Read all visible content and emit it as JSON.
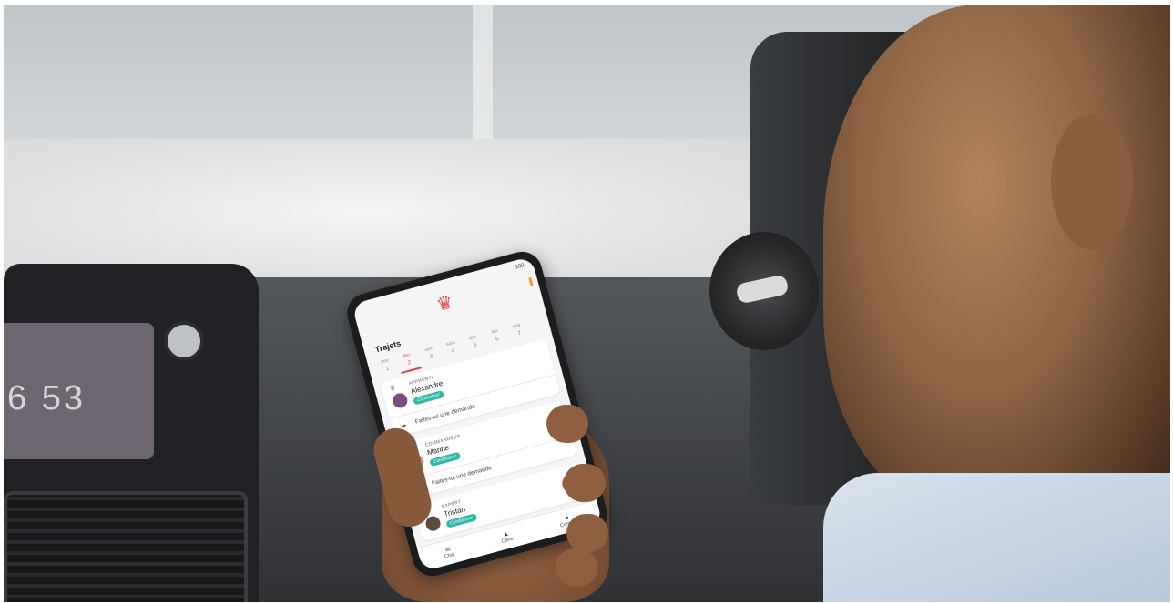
{
  "dashboard": {
    "clock_display": "6 53"
  },
  "phone": {
    "status_text": "100",
    "screen_title": "Trajets",
    "days": [
      {
        "label": "mar.",
        "num": "1"
      },
      {
        "label": "jeu.",
        "num": "2"
      },
      {
        "label": "ven.",
        "num": "3"
      },
      {
        "label": "sam.",
        "num": "4"
      },
      {
        "label": "dim.",
        "num": "5"
      },
      {
        "label": "lun.",
        "num": "6"
      },
      {
        "label": "mar.",
        "num": "7"
      }
    ],
    "cards": [
      {
        "role": "APPRENTI",
        "name": "Alexandre",
        "badge": "Conducteur",
        "request": "Faites-lui une demande"
      },
      {
        "role": "COMMANDEUR",
        "name": "Marine",
        "badge": "Conducteur",
        "request": "Faites-lui une demande"
      },
      {
        "role": "EXPERT",
        "name": "Tristan",
        "badge": "Conducteur",
        "request": ""
      }
    ],
    "fab_label": "+",
    "tabs": [
      {
        "label": "Chat",
        "icon": "chat-icon"
      },
      {
        "label": "Carte",
        "icon": "map-icon"
      },
      {
        "label": "Compte",
        "icon": "account-icon"
      }
    ],
    "accent_color": "#e0453f",
    "badge_color": "#2fb7a7"
  }
}
